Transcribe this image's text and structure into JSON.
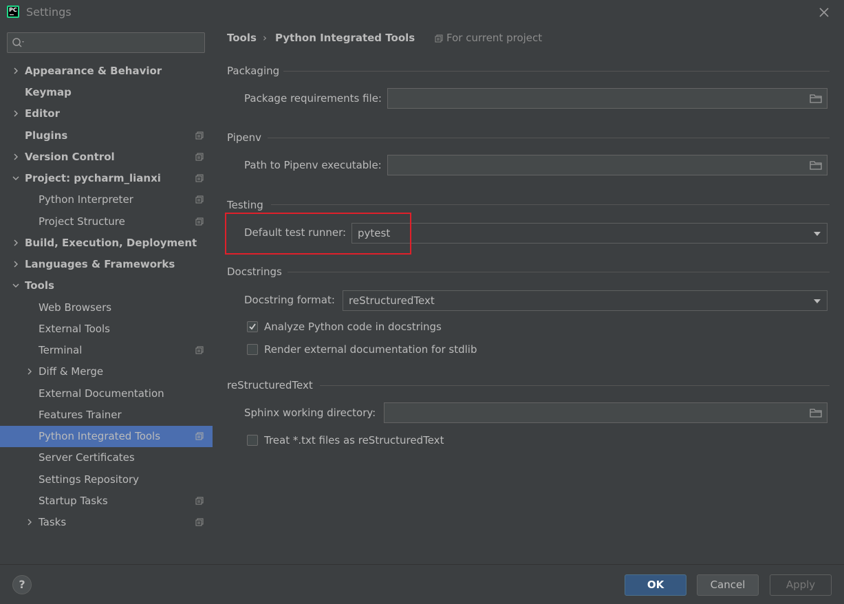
{
  "window": {
    "title": "Settings",
    "logo_text": "PC"
  },
  "sidebar": {
    "search_placeholder": "",
    "items": [
      {
        "label": "Appearance & Behavior"
      },
      {
        "label": "Keymap"
      },
      {
        "label": "Editor"
      },
      {
        "label": "Plugins"
      },
      {
        "label": "Version Control"
      },
      {
        "label": "Project: pycharm_lianxi"
      },
      {
        "label": "Python Interpreter"
      },
      {
        "label": "Project Structure"
      },
      {
        "label": "Build, Execution, Deployment"
      },
      {
        "label": "Languages & Frameworks"
      },
      {
        "label": "Tools"
      },
      {
        "label": "Web Browsers"
      },
      {
        "label": "External Tools"
      },
      {
        "label": "Terminal"
      },
      {
        "label": "Diff & Merge"
      },
      {
        "label": "External Documentation"
      },
      {
        "label": "Features Trainer"
      },
      {
        "label": "Python Integrated Tools"
      },
      {
        "label": "Server Certificates"
      },
      {
        "label": "Settings Repository"
      },
      {
        "label": "Startup Tasks"
      },
      {
        "label": "Tasks"
      }
    ]
  },
  "breadcrumb": {
    "parent": "Tools",
    "separator": "›",
    "current": "Python Integrated Tools",
    "scope": "For current project"
  },
  "sections": {
    "packaging": {
      "title": "Packaging",
      "requirements_label": "Package requirements file:",
      "requirements_value": ""
    },
    "pipenv": {
      "title": "Pipenv",
      "path_label": "Path to Pipenv executable:",
      "path_value": ""
    },
    "testing": {
      "title": "Testing",
      "runner_label": "Default test runner:",
      "runner_value": "pytest"
    },
    "docstrings": {
      "title": "Docstrings",
      "format_label": "Docstring format:",
      "format_value": "reStructuredText",
      "analyze_label": "Analyze Python code in docstrings",
      "analyze_checked": true,
      "render_label": "Render external documentation for stdlib",
      "render_checked": false
    },
    "rest": {
      "title": "reStructuredText",
      "sphinx_label": "Sphinx working directory:",
      "sphinx_value": "",
      "treat_label": "Treat *.txt files as reStructuredText",
      "treat_checked": false
    }
  },
  "footer": {
    "help_label": "?",
    "ok_label": "OK",
    "cancel_label": "Cancel",
    "apply_label": "Apply"
  },
  "colors": {
    "background": "#3c3f41",
    "selection": "#4b6eaf",
    "highlight_box": "#e0202a",
    "ok_button": "#365880"
  }
}
